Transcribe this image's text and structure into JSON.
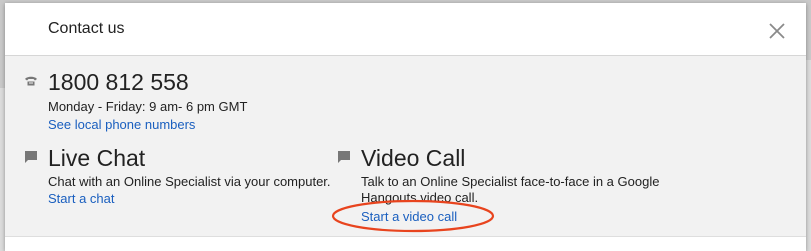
{
  "dialog": {
    "title": "Contact us",
    "close_icon": "close-icon"
  },
  "phone": {
    "icon": "phone-icon",
    "number": "1800 812 558",
    "hours": "Monday - Friday: 9 am- 6 pm GMT",
    "link": "See local phone numbers"
  },
  "live_chat": {
    "icon": "chat-bubble-icon",
    "title": "Live Chat",
    "description": "Chat with an Online Specialist via your computer.",
    "link": "Start a chat"
  },
  "video_call": {
    "icon": "chat-bubble-icon",
    "title": "Video Call",
    "description_line1": "Talk to an Online Specialist face-to-face in a Google",
    "description_line2": "Hangouts video call.",
    "link": "Start a video call"
  },
  "colors": {
    "link": "#1a5fbf",
    "annotation_circle": "#e8441e"
  }
}
